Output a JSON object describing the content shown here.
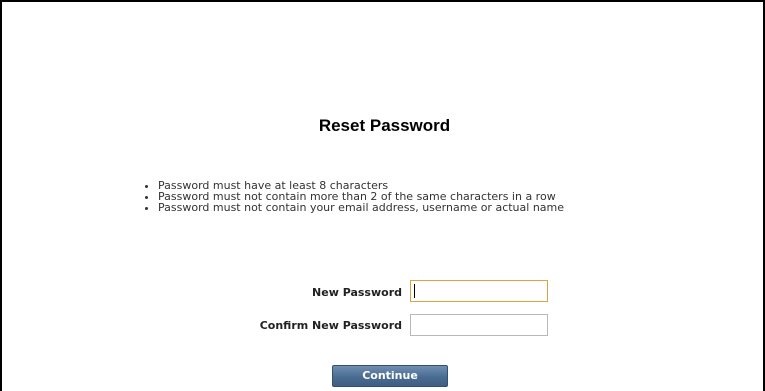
{
  "page": {
    "title": "Reset Password"
  },
  "rules": [
    "Password must have at least 8 characters",
    "Password must not contain more than 2 of the same characters in a row",
    "Password must not contain your email address, username or actual name"
  ],
  "form": {
    "new_password_label": "New Password",
    "new_password_value": "",
    "confirm_password_label": "Confirm New Password",
    "confirm_password_value": "",
    "continue_label": "Continue"
  },
  "colors": {
    "focused_border": "#d8a545",
    "button_bg": "#4b6c92"
  }
}
